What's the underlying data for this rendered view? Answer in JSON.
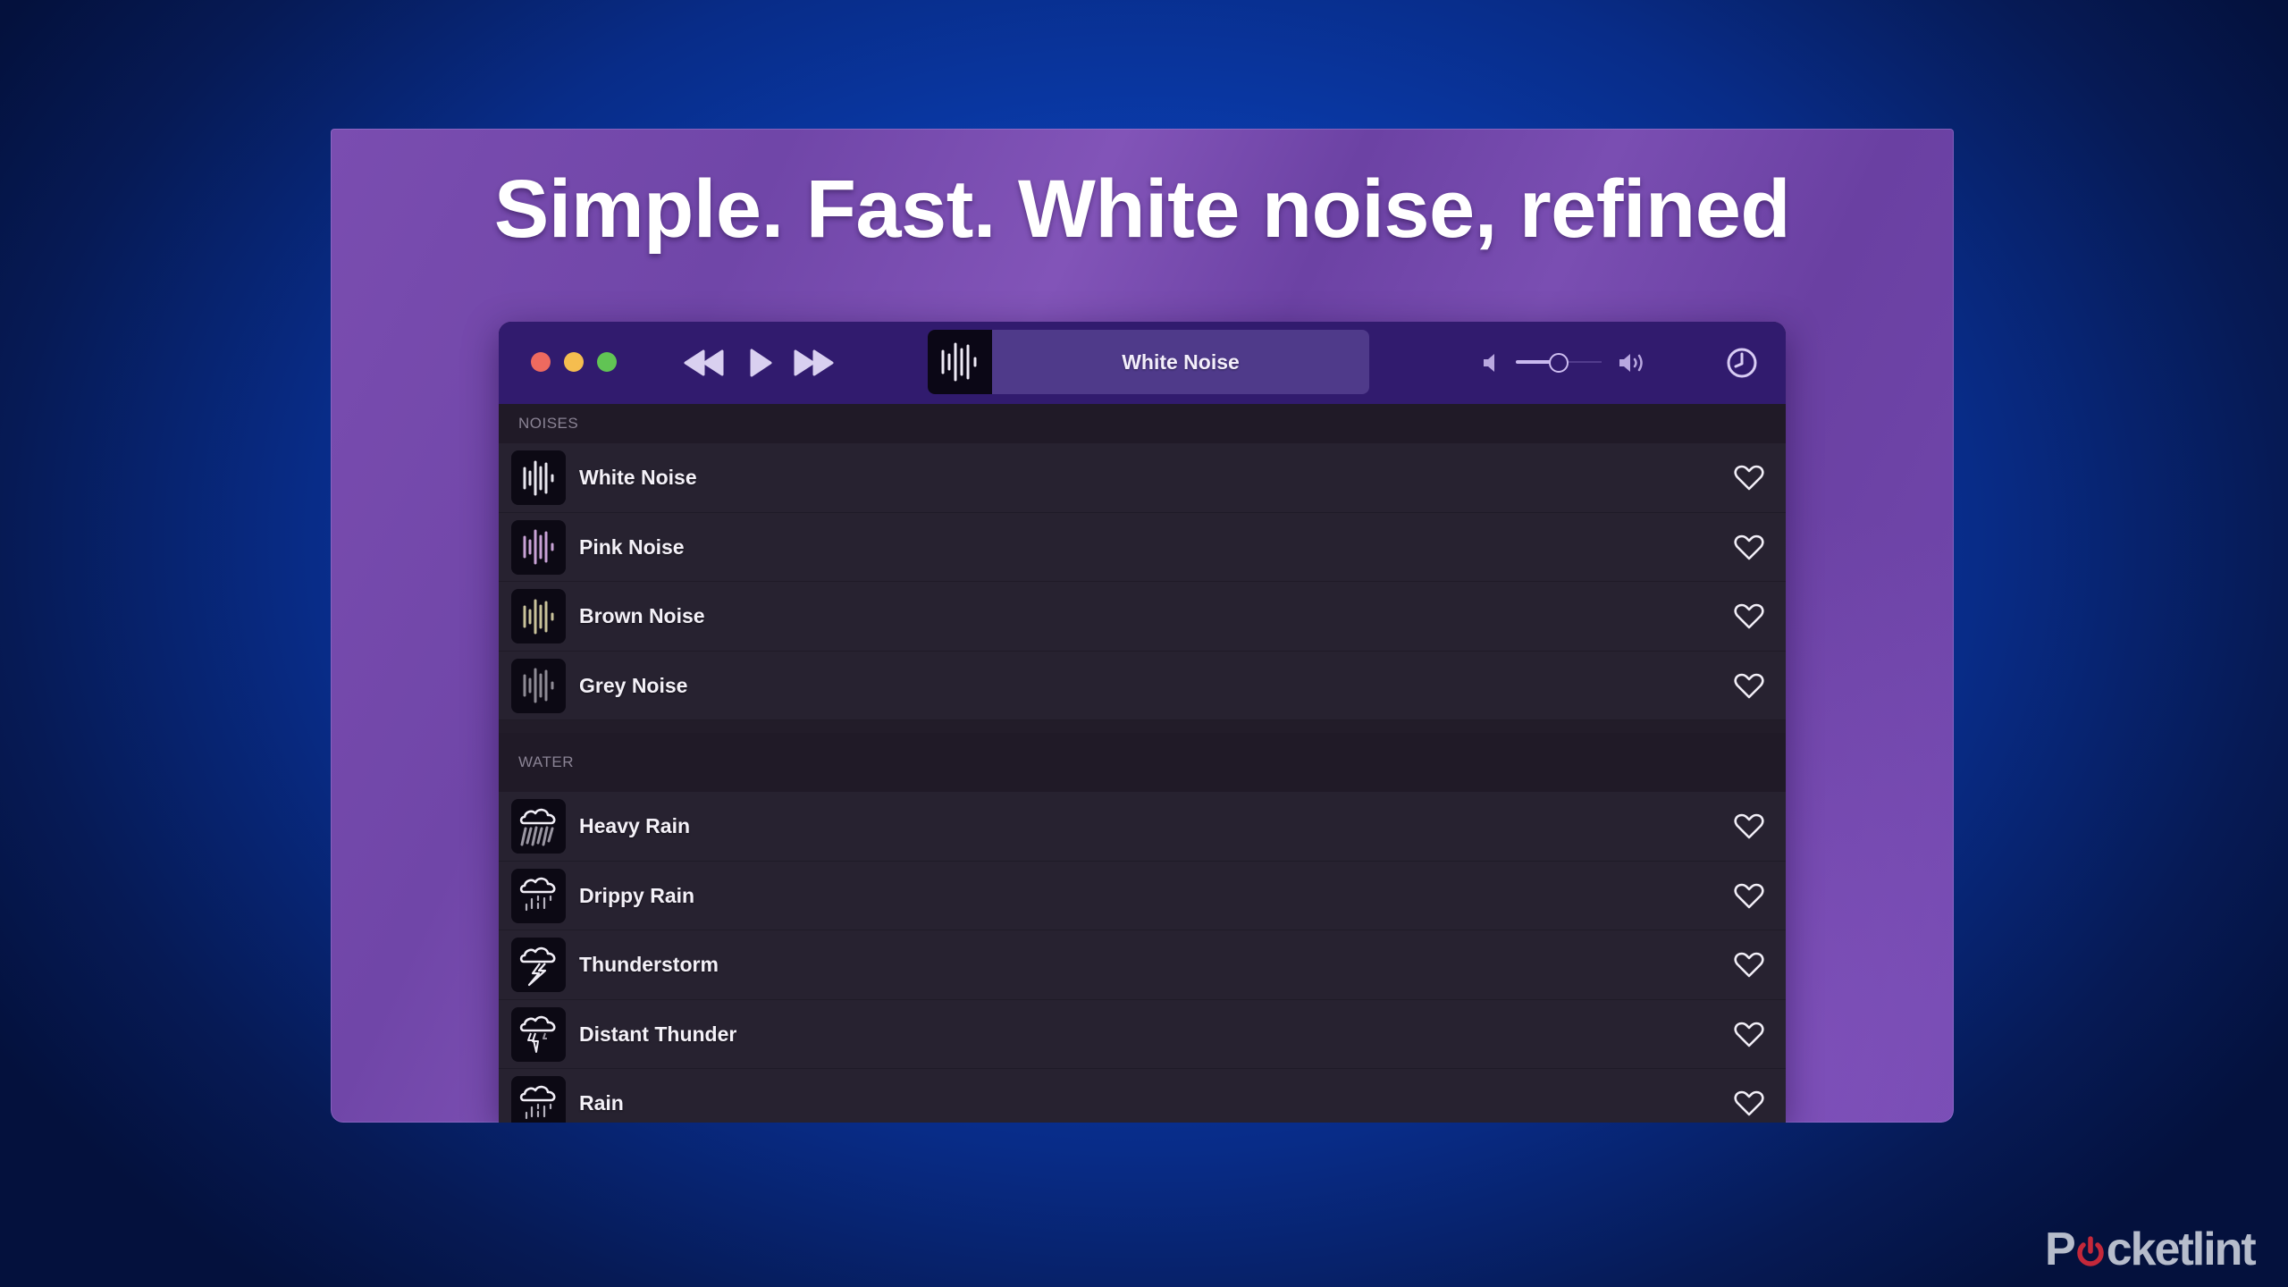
{
  "headline": "Simple. Fast. White noise, refined",
  "window": {
    "traffic_lights": [
      "close",
      "minimize",
      "zoom"
    ],
    "controls": {
      "rewind_icon": "rewind-icon",
      "play_icon": "play-icon",
      "forward_icon": "fast-forward-icon"
    },
    "now_playing": {
      "title": "White Noise",
      "art_icon": "waveform-icon"
    },
    "volume": {
      "level_percent": 50,
      "low_icon": "speaker-low-icon",
      "high_icon": "speaker-high-icon"
    },
    "timer_icon": "clock-icon"
  },
  "sections": [
    {
      "title": "NOISES",
      "items": [
        {
          "label": "White Noise",
          "icon": "waveform-icon",
          "icon_color": "#e8e6ee",
          "favorite": false
        },
        {
          "label": "Pink Noise",
          "icon": "waveform-icon",
          "icon_color": "#c9a2d6",
          "favorite": false
        },
        {
          "label": "Brown Noise",
          "icon": "waveform-icon",
          "icon_color": "#c9c29a",
          "favorite": false
        },
        {
          "label": "Grey Noise",
          "icon": "waveform-icon",
          "icon_color": "#8e8b95",
          "favorite": false
        }
      ]
    },
    {
      "title": "WATER",
      "items": [
        {
          "label": "Heavy Rain",
          "icon": "heavy-rain-icon",
          "favorite": false
        },
        {
          "label": "Drippy Rain",
          "icon": "drippy-rain-icon",
          "favorite": false
        },
        {
          "label": "Thunderstorm",
          "icon": "thunderstorm-icon",
          "favorite": false
        },
        {
          "label": "Distant Thunder",
          "icon": "distant-thunder-icon",
          "favorite": false
        },
        {
          "label": "Rain",
          "icon": "rain-icon",
          "favorite": false
        }
      ]
    }
  ],
  "watermark": {
    "text_before": "P",
    "text_after": "cketlint",
    "accent_color": "#c4283a"
  },
  "colors": {
    "titlebar": "#311b6e",
    "now_playing_bg": "#4f3a8a",
    "list_bg": "#272230"
  }
}
